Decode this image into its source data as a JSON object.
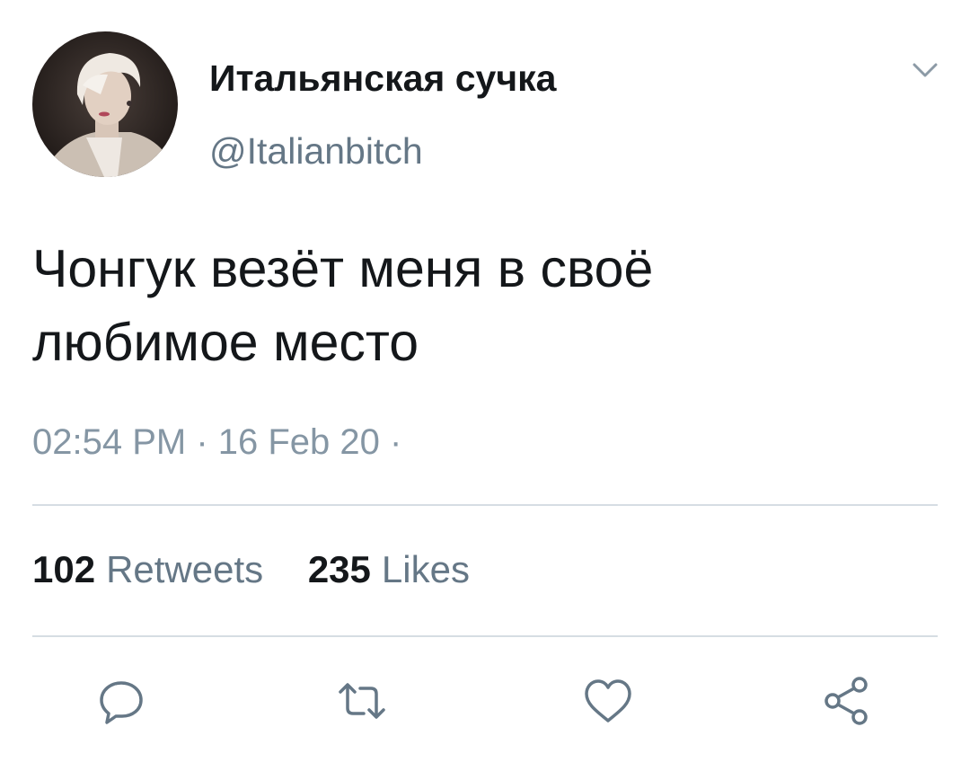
{
  "user": {
    "display_name": "Итальянская сучка",
    "handle": "@Italianbitch"
  },
  "tweet": {
    "text_line1": "Чонгук везёт меня в своё",
    "text_line2": "любимое место",
    "timestamp": "02:54 PM · 16 Feb 20 ·"
  },
  "stats": {
    "retweets_count": "102",
    "retweets_label": "Retweets",
    "likes_count": "235",
    "likes_label": "Likes"
  },
  "icons": {
    "caret": "chevron-down-icon",
    "reply": "reply-icon",
    "retweet": "retweet-icon",
    "like": "heart-icon",
    "share": "share-icon"
  },
  "colors": {
    "text_primary": "#14171a",
    "text_secondary": "#657786",
    "icon": "#657786",
    "divider": "#d6dde3"
  }
}
